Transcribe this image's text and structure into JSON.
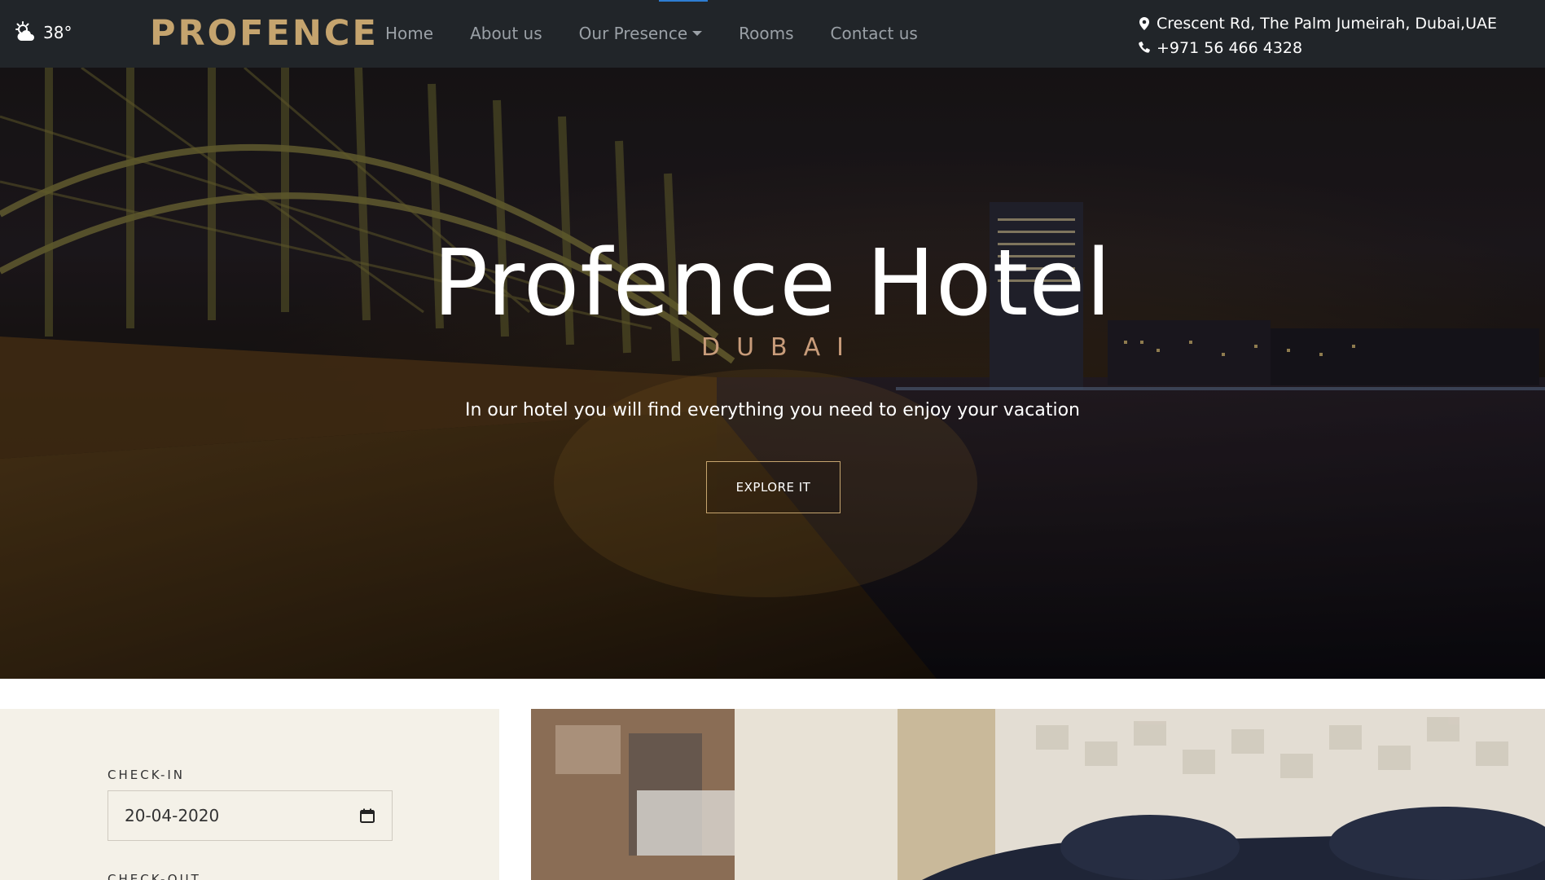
{
  "navbar": {
    "weather": {
      "icon": "weather-partly-cloudy-icon",
      "temperature": "38°"
    },
    "brand": "PROFENCE",
    "links": [
      {
        "label": "Home"
      },
      {
        "label": "About us"
      },
      {
        "label": "Our Presence",
        "dropdown": true
      },
      {
        "label": "Rooms"
      },
      {
        "label": "Contact us"
      }
    ],
    "address": "Crescent Rd, The Palm Jumeirah, Dubai,UAE",
    "phone": "+971 56 466 4328"
  },
  "hero": {
    "title": "Profence Hotel",
    "subtitle": "DUBAI",
    "description": "In our hotel you will find everything you need to enjoy your vacation",
    "button_label": "EXPLORE IT"
  },
  "booking": {
    "checkin_label": "CHECK-IN",
    "checkin_value": "20-04-2020",
    "checkout_label": "CHECK-OUT"
  },
  "colors": {
    "navbar_bg": "#212529",
    "brand_gold": "#c5a46e",
    "booking_bg": "#f4f1e8",
    "subtitle": "#c89c7a"
  }
}
